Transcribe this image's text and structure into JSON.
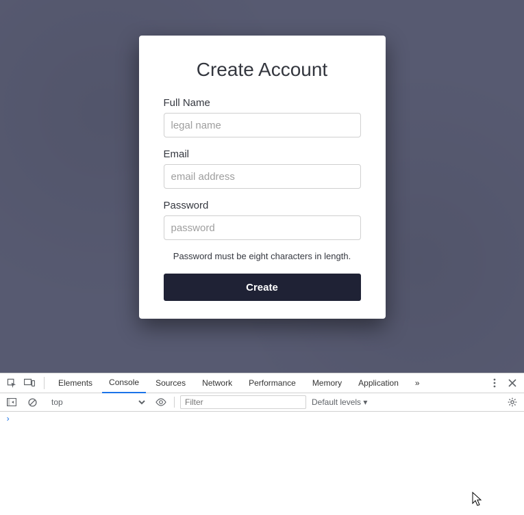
{
  "form": {
    "title": "Create Account",
    "fields": {
      "fullname": {
        "label": "Full Name",
        "placeholder": "legal name",
        "value": ""
      },
      "email": {
        "label": "Email",
        "placeholder": "email address",
        "value": ""
      },
      "password": {
        "label": "Password",
        "placeholder": "password",
        "value": ""
      }
    },
    "password_hint": "Password must be eight characters in length.",
    "submit_label": "Create"
  },
  "devtools": {
    "tabs": {
      "elements": "Elements",
      "console": "Console",
      "sources": "Sources",
      "network": "Network",
      "performance": "Performance",
      "memory": "Memory",
      "application": "Application"
    },
    "active_tab": "Console",
    "more_symbol": "»",
    "context_selector": "top",
    "filter_placeholder": "Filter",
    "levels_label": "Default levels ▾",
    "prompt_symbol": "›"
  }
}
